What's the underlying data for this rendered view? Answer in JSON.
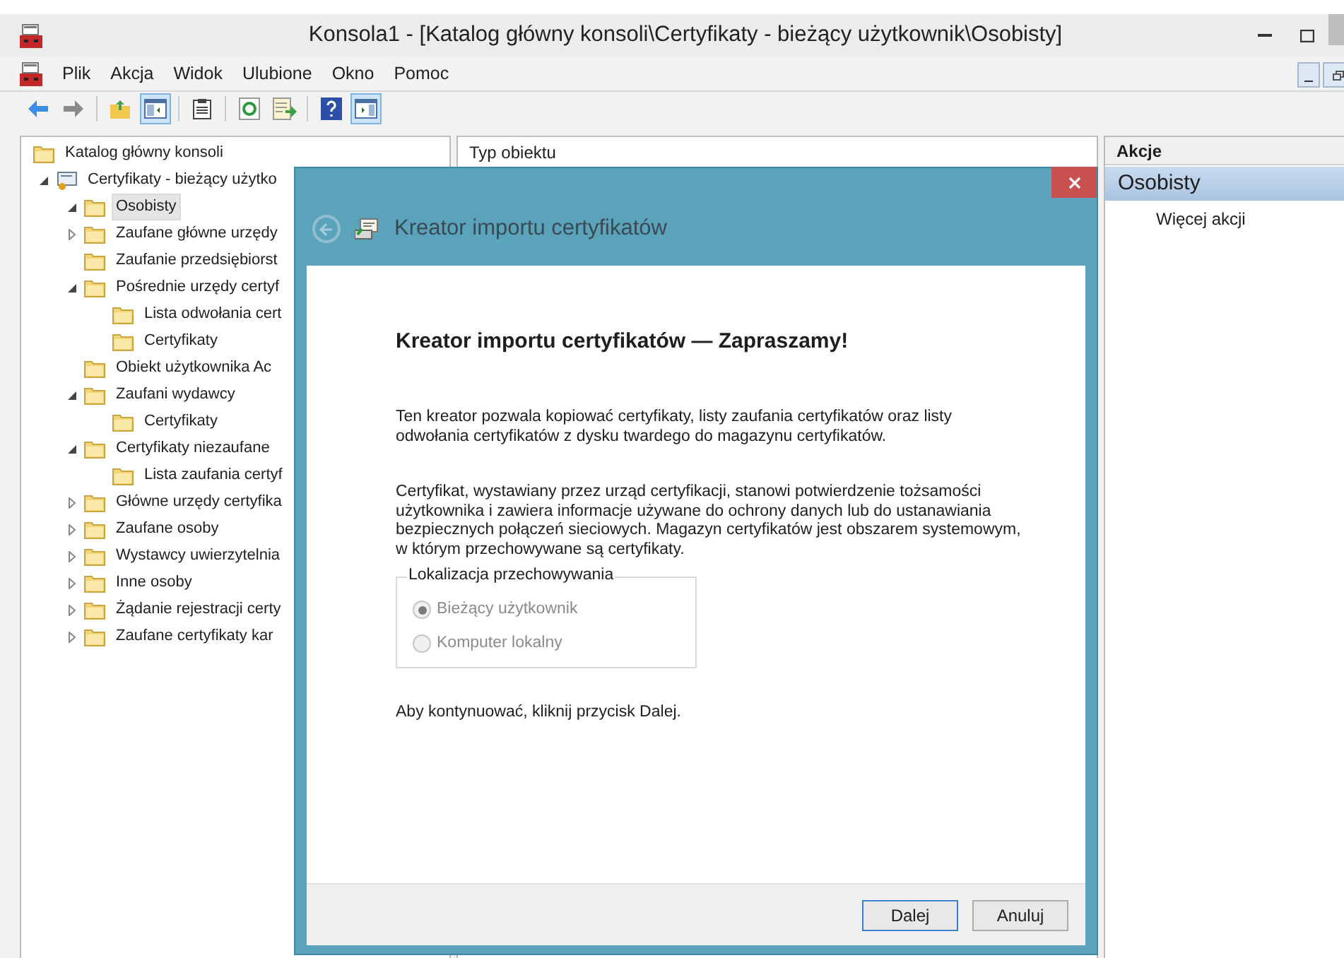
{
  "window": {
    "title": "Konsola1 - [Katalog główny konsoli\\Certyfikaty - bieżący użytkownik\\Osobisty]"
  },
  "menu": [
    "Plik",
    "Akcja",
    "Widok",
    "Ulubione",
    "Okno",
    "Pomoc"
  ],
  "toolbar": [
    {
      "kind": "back",
      "pressed": false
    },
    {
      "kind": "forward",
      "pressed": false
    },
    {
      "kind": "sep"
    },
    {
      "kind": "up",
      "pressed": false
    },
    {
      "kind": "tree",
      "pressed": true
    },
    {
      "kind": "sep"
    },
    {
      "kind": "clipboard",
      "pressed": false
    },
    {
      "kind": "sep"
    },
    {
      "kind": "refresh",
      "pressed": false
    },
    {
      "kind": "export",
      "pressed": false
    },
    {
      "kind": "sep"
    },
    {
      "kind": "help",
      "pressed": false
    },
    {
      "kind": "actions",
      "pressed": true
    }
  ],
  "tree": [
    {
      "label": "Katalog główny konsoli",
      "kind": "folder",
      "selected": false,
      "children": [
        {
          "label": "Certyfikaty - bieżący użytko",
          "kind": "store",
          "expanded": true,
          "selected": false,
          "children": [
            {
              "label": "Osobisty",
              "kind": "folder",
              "expanded": true,
              "selected": true
            },
            {
              "label": "Zaufane główne urzędy",
              "kind": "folder",
              "expanded": false,
              "selected": false
            },
            {
              "label": "Zaufanie przedsiębiorst",
              "kind": "folder",
              "selected": false
            },
            {
              "label": "Pośrednie urzędy certyf",
              "kind": "folder",
              "expanded": true,
              "selected": false,
              "children": [
                {
                  "label": "Lista odwołania cert",
                  "kind": "folder",
                  "selected": false
                },
                {
                  "label": "Certyfikaty",
                  "kind": "folder",
                  "selected": false
                }
              ]
            },
            {
              "label": "Obiekt użytkownika Ac",
              "kind": "folder",
              "selected": false
            },
            {
              "label": "Zaufani wydawcy",
              "kind": "folder",
              "expanded": true,
              "selected": false,
              "children": [
                {
                  "label": "Certyfikaty",
                  "kind": "folder",
                  "selected": false
                }
              ]
            },
            {
              "label": "Certyfikaty niezaufane",
              "kind": "folder",
              "expanded": true,
              "selected": false,
              "children": [
                {
                  "label": "Lista zaufania certyf",
                  "kind": "folder",
                  "selected": false
                }
              ]
            },
            {
              "label": "Główne urzędy certyfika",
              "kind": "folder",
              "expanded": false,
              "selected": false
            },
            {
              "label": "Zaufane osoby",
              "kind": "folder",
              "expanded": false,
              "selected": false
            },
            {
              "label": "Wystawcy uwierzytelnia",
              "kind": "folder",
              "expanded": false,
              "selected": false
            },
            {
              "label": "Inne osoby",
              "kind": "folder",
              "expanded": false,
              "selected": false
            },
            {
              "label": "Żądanie rejestracji certy",
              "kind": "folder",
              "expanded": false,
              "selected": false
            },
            {
              "label": "Zaufane certyfikaty kar",
              "kind": "folder",
              "expanded": false,
              "selected": false
            }
          ]
        }
      ]
    }
  ],
  "list": {
    "columns": [
      "Typ obiektu"
    ]
  },
  "actions": {
    "title": "Akcje",
    "section": "Osobisty",
    "items": [
      "Więcej akcji"
    ]
  },
  "dialog": {
    "title": "Kreator importu certyfikatów",
    "back_disabled": true,
    "heading": "Kreator importu certyfikatów — Zapraszamy!",
    "paragraphs": [
      "Ten kreator pozwala kopiować certyfikaty, listy zaufania certyfikatów oraz listy odwołania certyfikatów z dysku twardego do magazynu certyfikatów.",
      "Certyfikat, wystawiany przez urząd certyfikacji, stanowi potwierdzenie tożsamości użytkownika i zawiera informacje używane do ochrony danych lub do ustanawiania bezpiecznych połączeń sieciowych. Magazyn certyfikatów jest obszarem systemowym, w którym przechowywane są certyfikaty."
    ],
    "location": {
      "legend": "Lokalizacja przechowywania",
      "disabled": true,
      "options": [
        {
          "label": "Bieżący użytkownik",
          "selected": true
        },
        {
          "label": "Komputer lokalny",
          "selected": false
        }
      ]
    },
    "note": "Aby kontynuować, kliknij przycisk Dalej.",
    "buttons": [
      {
        "label": "Dalej",
        "default": true
      },
      {
        "label": "Anuluj",
        "default": false
      }
    ]
  }
}
